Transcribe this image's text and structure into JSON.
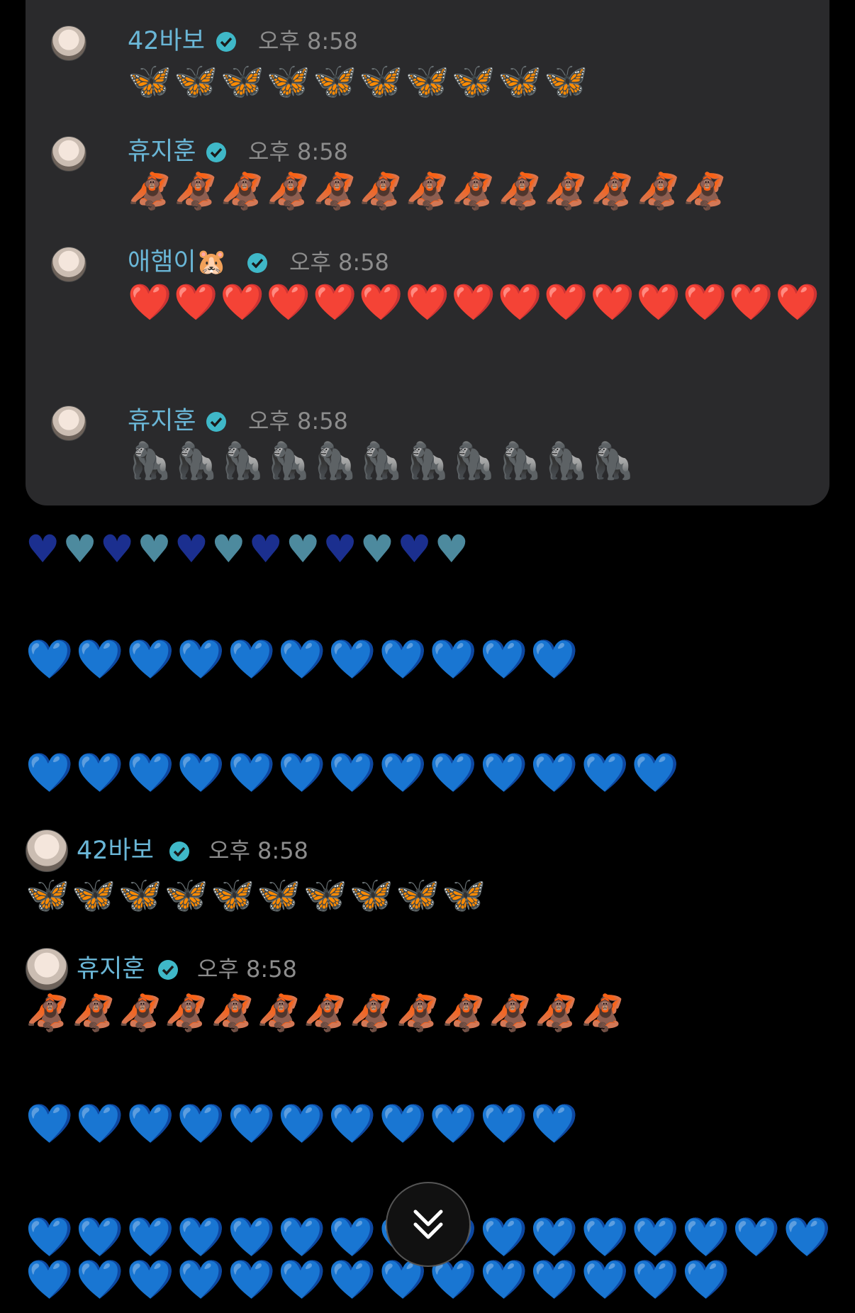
{
  "overlay_messages": [
    {
      "sender": "42바보",
      "time": "오후 8:58",
      "emojis": "🦋🦋🦋🦋🦋🦋🦋🦋🦋🦋"
    },
    {
      "sender": "휴지훈",
      "time": "오후 8:58",
      "emojis": "🦧🦧🦧🦧🦧🦧🦧🦧🦧🦧🦧🦧🦧"
    },
    {
      "sender": "애햄이🐹",
      "time": "오후 8:58",
      "emojis": "❤️❤️❤️❤️❤️❤️❤️❤️❤️❤️❤️❤️❤️❤️❤️"
    },
    {
      "sender": "휴지훈",
      "time": "오후 8:58",
      "emojis": "🦍🦍🦍🦍🦍🦍🦍🦍🦍🦍🦍"
    }
  ],
  "chat": {
    "row1": "💙💙💙💙💙💙💙💙💙💙💙💙",
    "row2": "💙💙💙💙💙💙💙💙💙💙💙",
    "row3": "💙💙💙💙💙💙💙💙💙💙💙💙💙",
    "msg1": {
      "sender": "42바보",
      "time": "오후 8:58",
      "emojis": "🦋🦋🦋🦋🦋🦋🦋🦋🦋🦋"
    },
    "msg2": {
      "sender": "휴지훈",
      "time": "오후 8:58",
      "emojis": "🦧🦧🦧🦧🦧🦧🦧🦧🦧🦧🦧🦧🦧"
    },
    "row4": "💙💙💙💙💙💙💙💙💙💙💙",
    "row5": "💙💙💙💙💙💙💙💙💙💙💙💙💙💙💙💙",
    "row6": "💙💙💙💙💙💙💙💙💙💙💙💙💙💙"
  },
  "scroll_button": {
    "icon": "double-chevron-down-icon"
  },
  "colors": {
    "name": "#6ab6d6",
    "time": "#8c8c8c",
    "verified": "#3fb8c8",
    "overlay_bg": "#2a2a2c"
  }
}
